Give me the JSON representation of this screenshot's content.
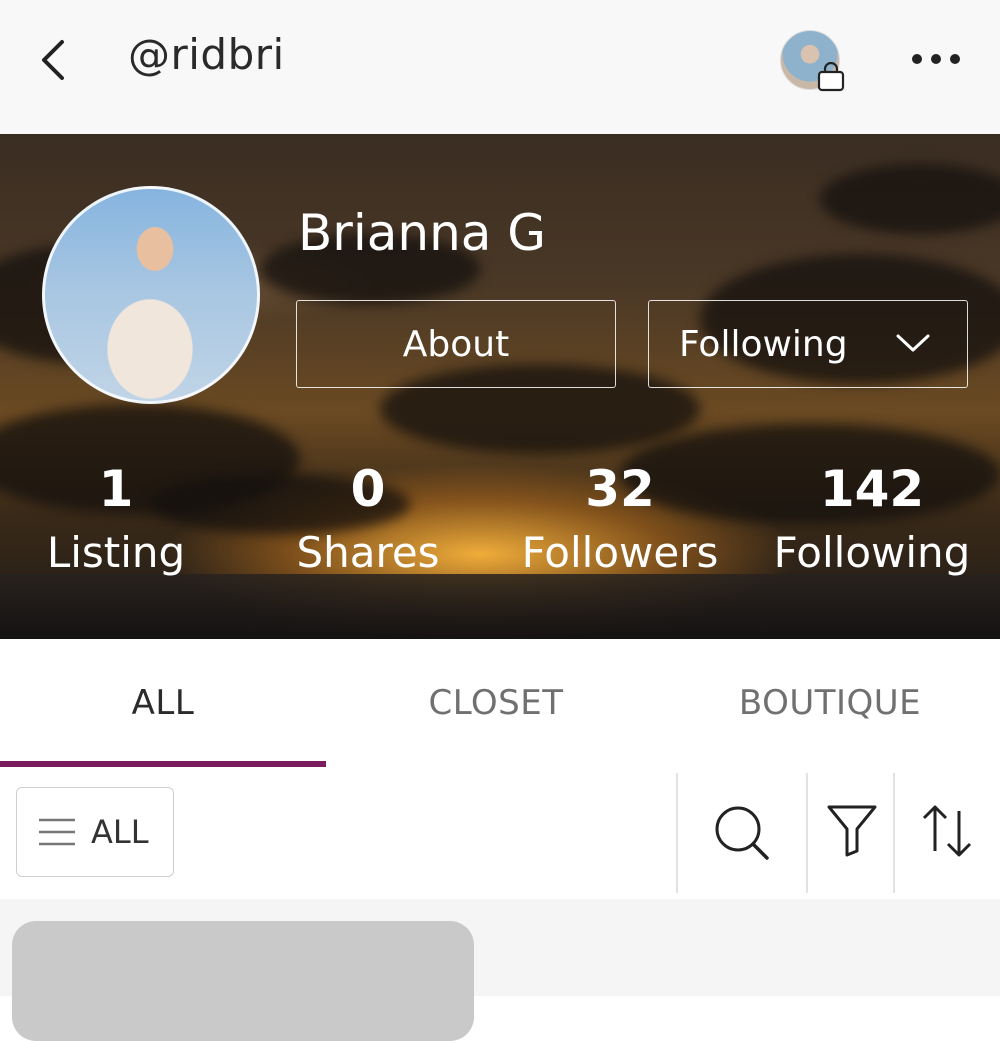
{
  "header": {
    "handle": "@ridbri",
    "back_icon": "chevron-left-icon",
    "shop_icon": "shopping-bag-icon",
    "more_icon": "more-horizontal-icon"
  },
  "profile": {
    "name": "Brianna G",
    "about_label": "About",
    "following_label": "Following",
    "stats": [
      {
        "value": "1",
        "label": "Listing"
      },
      {
        "value": "0",
        "label": "Shares"
      },
      {
        "value": "32",
        "label": "Followers"
      },
      {
        "value": "142",
        "label": "Following"
      }
    ]
  },
  "tabs": [
    {
      "label": "ALL",
      "active": true
    },
    {
      "label": "CLOSET",
      "active": false
    },
    {
      "label": "BOUTIQUE",
      "active": false
    }
  ],
  "toolbar": {
    "filter_label": "ALL",
    "icons": [
      "search-icon",
      "filter-icon",
      "sort-icon"
    ]
  },
  "colors": {
    "accent": "#7b1c5e",
    "text_dark": "#2b2b2b",
    "text_muted": "#707070"
  }
}
